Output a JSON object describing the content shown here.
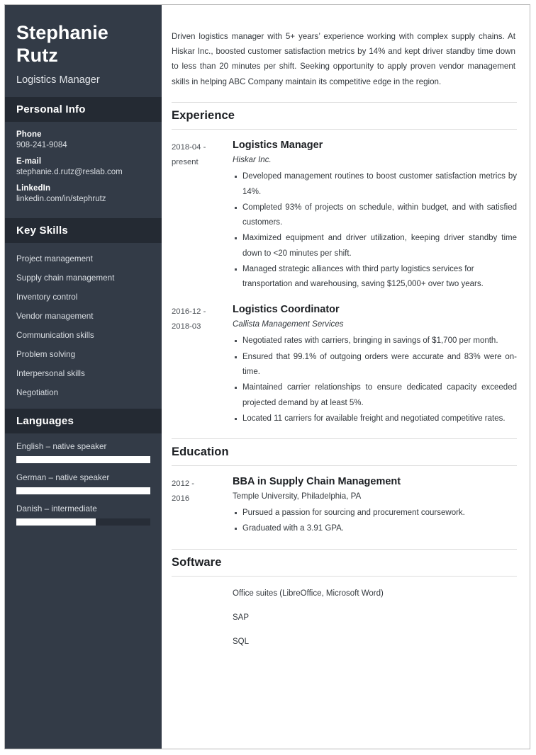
{
  "sidebar": {
    "name": "Stephanie Rutz",
    "job_title": "Logistics Manager",
    "personal_info": {
      "heading": "Personal Info",
      "items": [
        {
          "label": "Phone",
          "value": "908-241-9084"
        },
        {
          "label": "E-mail",
          "value": "stephanie.d.rutz@reslab.com"
        },
        {
          "label": "LinkedIn",
          "value": "linkedin.com/in/stephrutz"
        }
      ]
    },
    "key_skills": {
      "heading": "Key Skills",
      "items": [
        "Project management",
        "Supply chain management",
        "Inventory control",
        "Vendor management",
        "Communication skills",
        "Problem solving",
        "Interpersonal skills",
        "Negotiation"
      ]
    },
    "languages": {
      "heading": "Languages",
      "items": [
        {
          "label": "English – native speaker",
          "level_percent": 100
        },
        {
          "label": "German – native speaker",
          "level_percent": 100
        },
        {
          "label": "Danish – intermediate",
          "level_percent": 59
        }
      ]
    }
  },
  "main": {
    "summary": "Driven logistics manager with 5+ years’ experience working with complex supply chains. At Hiskar Inc., boosted customer satisfaction metrics by 14% and kept driver standby time down to less than 20 minutes per shift. Seeking opportunity to apply proven vendor management skills in helping ABC Company maintain its competitive edge in the region.",
    "experience": {
      "heading": "Experience",
      "entries": [
        {
          "date_line1": "2018-04 -",
          "date_line2": "present",
          "role": "Logistics Manager",
          "organization": "Hiskar Inc.",
          "bullets": [
            "Developed management routines to boost customer satisfaction metrics by 14%.",
            "Completed 93% of projects on schedule, within budget, and with satisfied customers.",
            "Maximized equipment and driver utilization, keeping driver standby time down to <20 minutes per shift.",
            "Managed strategic alliances with third party logistics services for transportation and warehousing, saving $125,000+ over two years."
          ]
        },
        {
          "date_line1": "2016-12 -",
          "date_line2": "2018-03",
          "role": "Logistics Coordinator",
          "organization": "Callista Management Services",
          "bullets": [
            "Negotiated rates with carriers, bringing in savings of $1,700 per month.",
            "Ensured that 99.1% of outgoing orders were accurate and 83% were on-time.",
            "Maintained carrier relationships to ensure dedicated capacity exceeded projected demand by at least 5%.",
            "Located 11 carriers for available freight and negotiated competitive rates."
          ]
        }
      ]
    },
    "education": {
      "heading": "Education",
      "entries": [
        {
          "date_line1": "2012 -",
          "date_line2": "2016",
          "degree": "BBA in Supply Chain Management",
          "school": "Temple University, Philadelphia, PA",
          "bullets": [
            "Pursued a passion for sourcing and procurement coursework.",
            "Graduated with a 3.91 GPA."
          ]
        }
      ]
    },
    "software": {
      "heading": "Software",
      "items": [
        "Office suites (LibreOffice, Microsoft Word)",
        "SAP",
        "SQL"
      ]
    }
  },
  "colors": {
    "sidebar_background": "#333b47",
    "sidebar_header_background": "#242a33",
    "text_dark": "#1c1f23",
    "bar_fill": "#ffffff"
  }
}
